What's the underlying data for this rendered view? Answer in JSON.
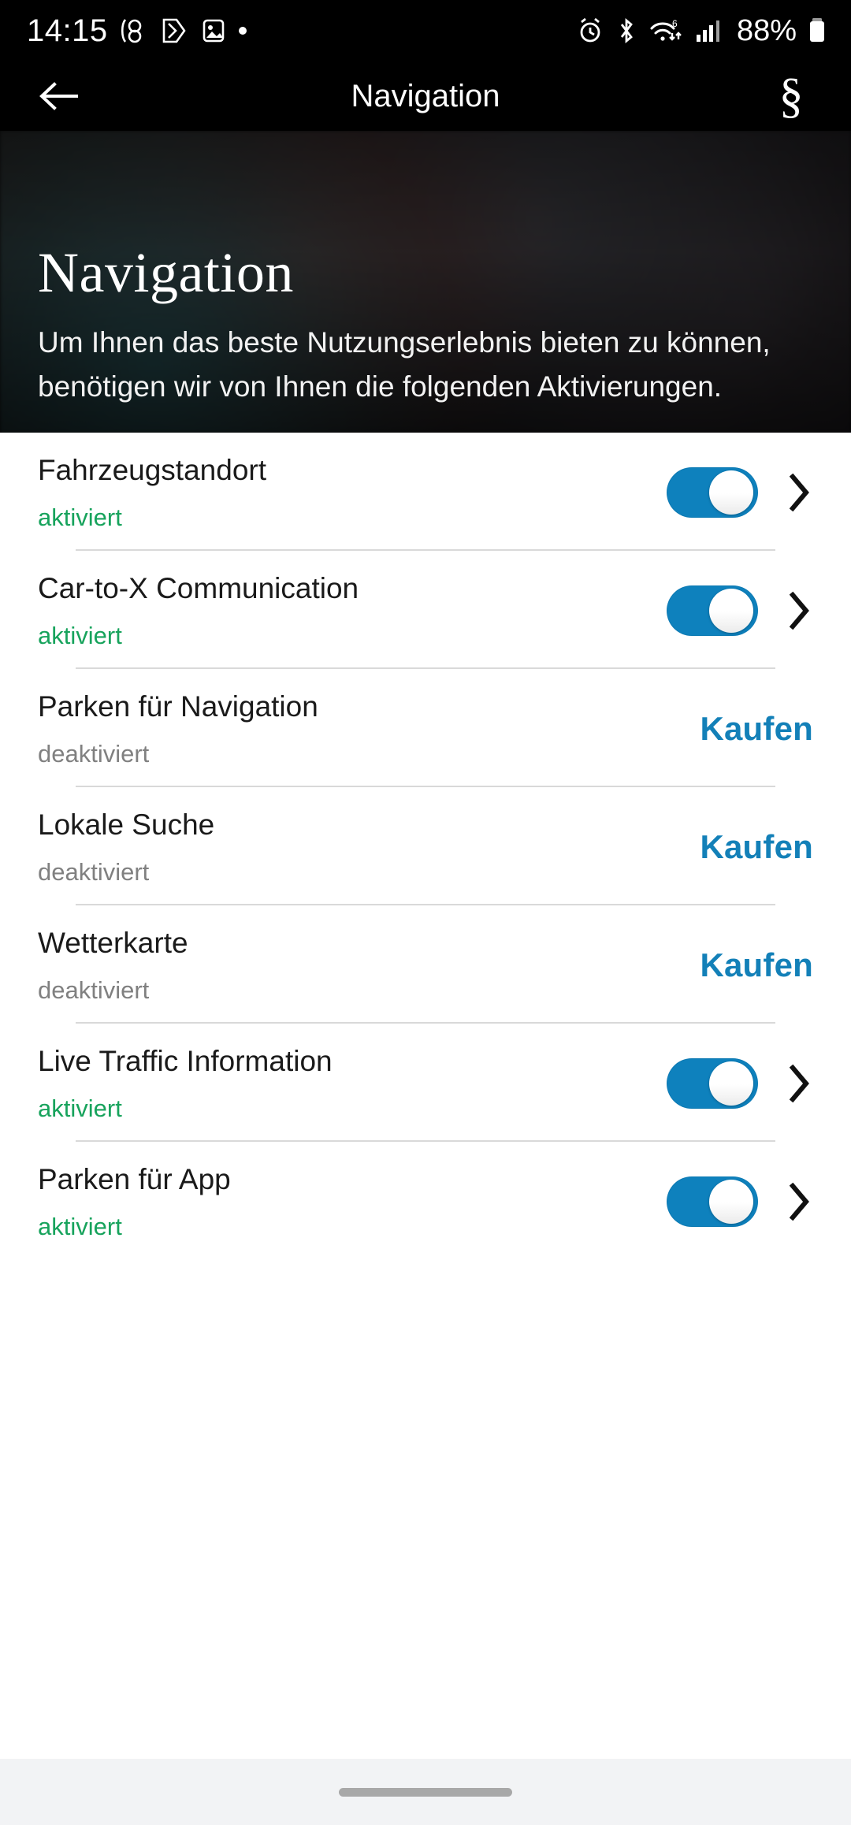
{
  "status_bar": {
    "time": "14:15",
    "battery_percent": "88%",
    "left_icons": [
      "dual-sim-icon",
      "vpn-shield-icon",
      "image-icon",
      "dot-indicator-icon"
    ],
    "right_icons": [
      "alarm-icon",
      "bluetooth-icon",
      "wifi-6-icon",
      "cellular-signal-icon",
      "battery-icon"
    ]
  },
  "app_bar": {
    "title": "Navigation",
    "back_icon": "back-arrow-icon",
    "legal_icon": "section-sign-icon",
    "legal_glyph": "§"
  },
  "hero": {
    "title": "Navigation",
    "description": "Um Ihnen das beste Nutzungserlebnis bieten zu können, benötigen wir von Ihnen die folgenden Aktivierungen."
  },
  "colors": {
    "accent_blue": "#0e81bd",
    "link_blue": "#1380b8",
    "state_on_green": "#17a35c",
    "state_off_gray": "#808080",
    "appbar_black": "#000000",
    "separator": "#d9d9d9"
  },
  "list": {
    "rows": [
      {
        "label": "Fahrzeugstandort",
        "state": "aktiviert",
        "control": "toggle",
        "toggle_on": true,
        "has_chevron": true
      },
      {
        "label": "Car-to-X Communication",
        "state": "aktiviert",
        "control": "toggle",
        "toggle_on": true,
        "has_chevron": true
      },
      {
        "label": "Parken für Navigation",
        "state": "deaktiviert",
        "control": "buy",
        "buy_label": "Kaufen",
        "has_chevron": false
      },
      {
        "label": "Lokale Suche",
        "state": "deaktiviert",
        "control": "buy",
        "buy_label": "Kaufen",
        "has_chevron": false
      },
      {
        "label": "Wetterkarte",
        "state": "deaktiviert",
        "control": "buy",
        "buy_label": "Kaufen",
        "has_chevron": false
      },
      {
        "label": "Live Traffic Information",
        "state": "aktiviert",
        "control": "toggle",
        "toggle_on": true,
        "has_chevron": true
      },
      {
        "label": "Parken für App",
        "state": "aktiviert",
        "control": "toggle",
        "toggle_on": true,
        "has_chevron": true
      }
    ]
  },
  "gesture_bar": {
    "handle": "home-gesture-handle"
  }
}
